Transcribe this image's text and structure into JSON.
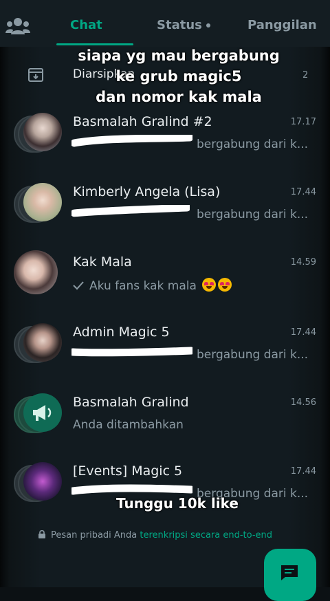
{
  "tabs": {
    "chat": "Chat",
    "status": "Status",
    "calls": "Panggilan"
  },
  "archived": {
    "label": "Diarsipkan",
    "count": "2"
  },
  "chats": [
    {
      "name": "Basmalah Gralind #2",
      "time": "17.17",
      "preview": "bergabung dari k..."
    },
    {
      "name": "Kimberly Angela (Lisa)",
      "time": "17.44",
      "preview": "bergabung dari k..."
    },
    {
      "name": "Kak Mala",
      "time": "14.59",
      "preview": "Aku fans kak mala"
    },
    {
      "name": "Admin Magic 5",
      "time": "17.44",
      "preview": "bergabung dari k..."
    },
    {
      "name": "Basmalah Gralind",
      "time": "14.56",
      "preview": "Anda ditambahkan"
    },
    {
      "name": "[Events] Magic 5",
      "time": "17.44",
      "preview": "bergabung dari k..."
    }
  ],
  "overlay": {
    "caption_line1": "siapa yg mau bergabung",
    "caption_line2": "ke grub magic5",
    "caption_line3": "dan nomor kak mala",
    "bottom_text": "Tunggu 10k like"
  },
  "footer": {
    "note_prefix": "Pesan pribadi Anda",
    "note_link": "terenkripsi secara end-to-end"
  },
  "colors": {
    "accent": "#00a884",
    "background": "#121b20",
    "muted_text": "#8b9aa3"
  },
  "icons": {
    "community": "community-icon",
    "archive": "archive-icon",
    "read_tick": "check-icon",
    "megaphone": "megaphone-icon",
    "lock": "lock-icon",
    "new_chat": "new-chat-icon"
  }
}
